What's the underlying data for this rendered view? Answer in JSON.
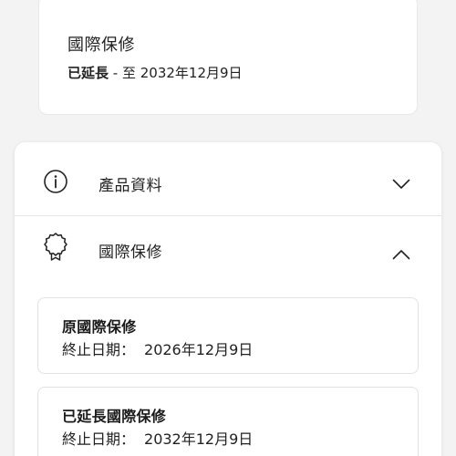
{
  "summary": {
    "title": "國際保修",
    "status_strong": "已延長",
    "status_rest": " - 至 2032年12月9日"
  },
  "accordion": {
    "product_info": {
      "label": "產品資料",
      "icon": "info-icon",
      "expanded": false
    },
    "warranty": {
      "label": "國際保修",
      "icon": "award-ribbon-icon",
      "expanded": true,
      "items": [
        {
          "title": "原國際保修",
          "date_label": "終止日期：",
          "date_value": "2026年12月9日"
        },
        {
          "title": "已延長國際保修",
          "date_label": "終止日期：",
          "date_value": "2032年12月9日"
        }
      ]
    }
  },
  "colors": {
    "background": "#f3f3f3",
    "card": "#ffffff",
    "text": "#222222",
    "border": "#e2e2e2"
  }
}
